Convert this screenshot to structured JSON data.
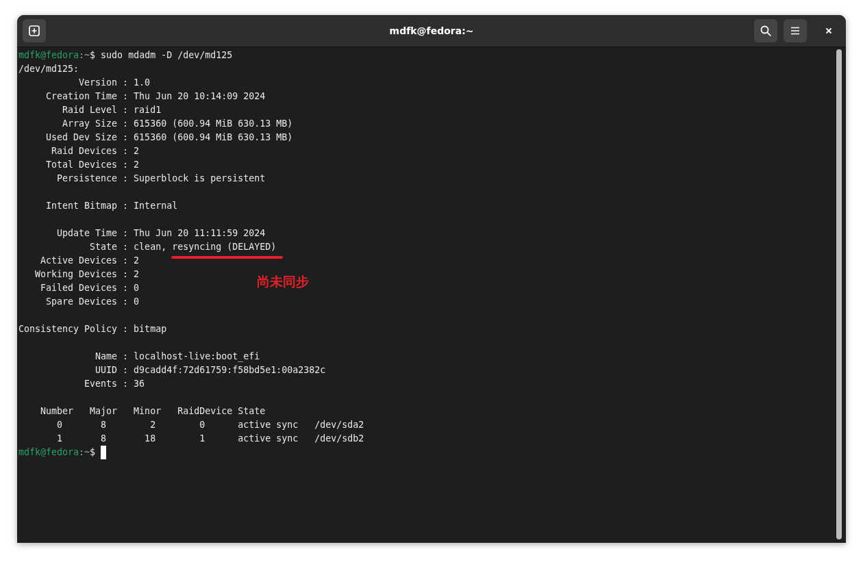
{
  "window": {
    "title": "mdfk@fedora:~"
  },
  "header": {
    "left_buttons": [
      {
        "kind": "new-tab"
      }
    ],
    "right_buttons": [
      {
        "kind": "search"
      },
      {
        "kind": "menu"
      },
      {
        "kind": "close"
      }
    ]
  },
  "terminal": {
    "lines": [
      {
        "kind": "prompt",
        "user_host": "mdfk@fedora",
        "path": ":~",
        "symbol": "$",
        "command": "sudo mdadm -D /dev/md125",
        "cursor": false
      },
      {
        "kind": "output",
        "text": "/dev/md125:"
      },
      {
        "kind": "output",
        "text": "           Version : 1.0"
      },
      {
        "kind": "output",
        "text": "     Creation Time : Thu Jun 20 10:14:09 2024"
      },
      {
        "kind": "output",
        "text": "        Raid Level : raid1"
      },
      {
        "kind": "output",
        "text": "        Array Size : 615360 (600.94 MiB 630.13 MB)"
      },
      {
        "kind": "output",
        "text": "     Used Dev Size : 615360 (600.94 MiB 630.13 MB)"
      },
      {
        "kind": "output",
        "text": "      Raid Devices : 2"
      },
      {
        "kind": "output",
        "text": "     Total Devices : 2"
      },
      {
        "kind": "output",
        "text": "       Persistence : Superblock is persistent"
      },
      {
        "kind": "blank"
      },
      {
        "kind": "output",
        "text": "     Intent Bitmap : Internal"
      },
      {
        "kind": "blank"
      },
      {
        "kind": "output",
        "text": "       Update Time : Thu Jun 20 11:11:59 2024"
      },
      {
        "kind": "output",
        "text": "             State : clean,",
        "highlight": "resyncing (DELAYED)",
        "note": "尚未同步"
      },
      {
        "kind": "output",
        "text": "    Active Devices : 2"
      },
      {
        "kind": "output",
        "text": "   Working Devices : 2"
      },
      {
        "kind": "output",
        "text": "    Failed Devices : 0"
      },
      {
        "kind": "output",
        "text": "     Spare Devices : 0"
      },
      {
        "kind": "blank"
      },
      {
        "kind": "output",
        "text": "Consistency Policy : bitmap"
      },
      {
        "kind": "blank"
      },
      {
        "kind": "output",
        "text": "              Name : localhost-live:boot_efi"
      },
      {
        "kind": "output",
        "text": "              UUID : d9cadd4f:72d61759:f58bd5e1:00a2382c"
      },
      {
        "kind": "output",
        "text": "            Events : 36"
      },
      {
        "kind": "blank"
      },
      {
        "kind": "output",
        "text": "    Number   Major   Minor   RaidDevice State"
      },
      {
        "kind": "output",
        "text": "       0       8        2        0      active sync   /dev/sda2"
      },
      {
        "kind": "output",
        "text": "       1       8       18        1      active sync   /dev/sdb2"
      },
      {
        "kind": "prompt",
        "user_host": "mdfk@fedora",
        "path": ":~",
        "symbol": "$",
        "cursor": true
      }
    ]
  }
}
